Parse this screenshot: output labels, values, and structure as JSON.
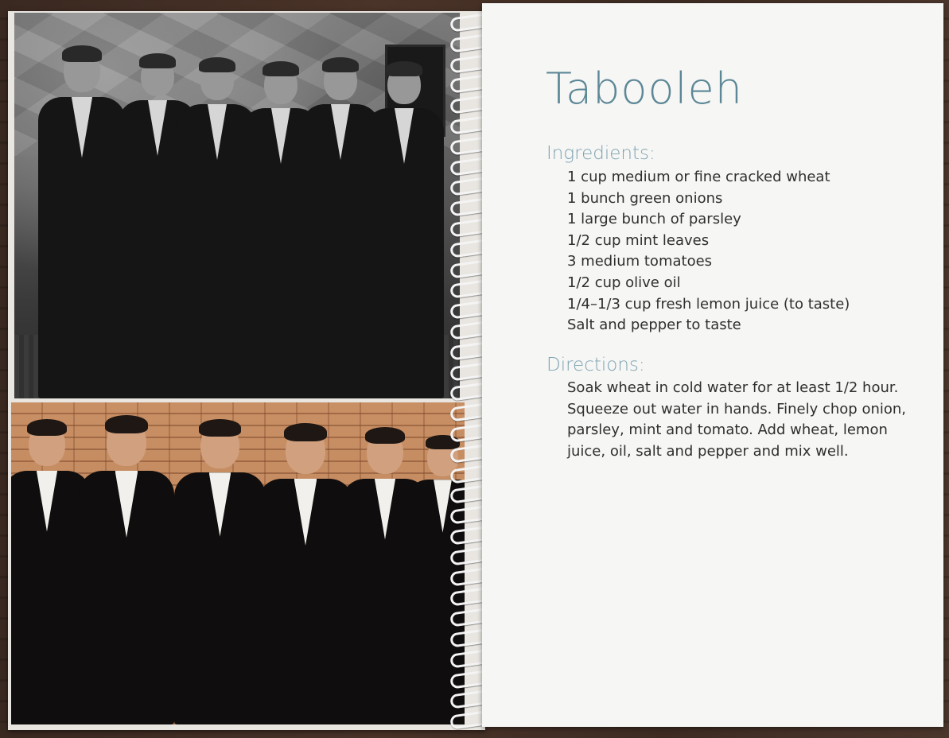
{
  "recipe": {
    "title": "Tabooleh",
    "ingredients_heading": "Ingredients:",
    "ingredients": [
      "1 cup medium or fine cracked wheat",
      "1 bunch green onions",
      "1 large bunch of parsley",
      "1/2 cup mint leaves",
      "3 medium tomatoes",
      "1/2 cup olive oil",
      "1/4–1/3 cup fresh lemon juice (to taste)",
      "Salt and pepper to taste"
    ],
    "directions_heading": "Directions:",
    "directions": "Soak wheat in cold water for at least 1/2 hour. Squeeze out water in hands. Finely chop onion, parsley, mint and tomato. Add wheat, lemon juice, oil, salt and pepper and mix well."
  },
  "colors": {
    "title": "#5c8797",
    "heading": "#7ea3b2",
    "body_text": "#2f2f2f",
    "page": "#f6f6f4"
  }
}
